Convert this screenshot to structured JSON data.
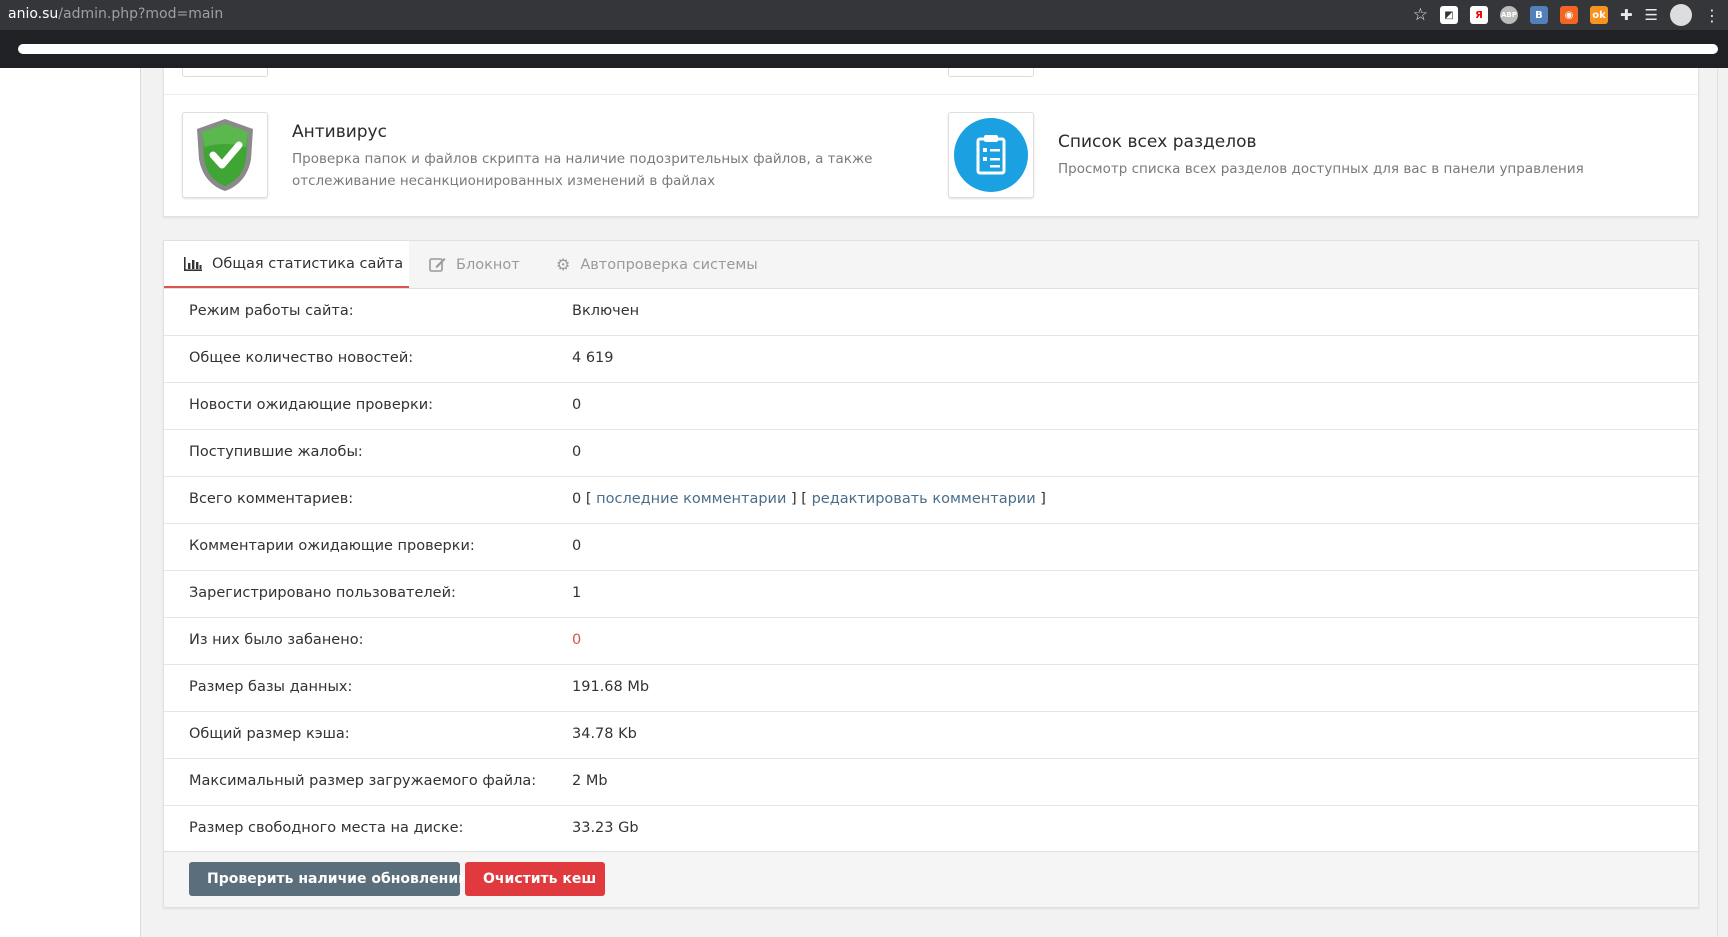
{
  "browser": {
    "url_host": "anio.su",
    "url_path": "/admin.php?mod=main"
  },
  "quick_links": [
    {
      "title": "Антивирус",
      "description_line1": "Проверка папок и файлов скрипта на наличие подозрительных файлов, а также",
      "description_line2": "отслеживание несанкционированных изменений в файлах",
      "icon": "shield-check-icon"
    },
    {
      "title": "Список всех разделов",
      "description_line1": "Просмотр списка всех разделов доступных для вас в панели управления",
      "icon": "clipboard-list-icon"
    }
  ],
  "tabs": [
    {
      "label": "Общая статистика сайта",
      "icon": "bar-chart-icon",
      "active": true
    },
    {
      "label": "Блокнот",
      "icon": "edit-icon",
      "active": false
    },
    {
      "label": "Автопроверка системы",
      "icon": "gear-icon",
      "active": false
    }
  ],
  "stats": [
    {
      "label": "Режим работы сайта:",
      "value": "Включен"
    },
    {
      "label": "Общее количество новостей:",
      "value": "4 619"
    },
    {
      "label": "Новости ожидающие проверки:",
      "value": "0"
    },
    {
      "label": "Поступившие жалобы:",
      "value": "0"
    },
    {
      "label": "Всего комментариев:",
      "value": "0"
    },
    {
      "label": "Комментарии ожидающие проверки:",
      "value": "0"
    },
    {
      "label": "Зарегистрировано пользователей:",
      "value": "1"
    },
    {
      "label": "Из них было забанено:",
      "value": "0"
    },
    {
      "label": "Размер базы данных:",
      "value": "191.68 Mb"
    },
    {
      "label": "Общий размер кэша:",
      "value": "34.78 Kb"
    },
    {
      "label": "Максимальный размер загружаемого файла:",
      "value": "2 Mb"
    },
    {
      "label": "Размер свободного места на диске:",
      "value": "33.23 Gb"
    }
  ],
  "comments_links": {
    "open_bracket": "[",
    "close_bracket": "]",
    "latest": "последние комментарии",
    "edit": "редактировать комментарии"
  },
  "buttons": {
    "check_updates": "Проверить наличие обновлений",
    "clear_cache": "Очистить кеш"
  },
  "colors": {
    "accent_red": "#d9534f",
    "button_gray": "#5a6f7b",
    "button_red": "#e0393e",
    "link": "#4a6e8a"
  }
}
